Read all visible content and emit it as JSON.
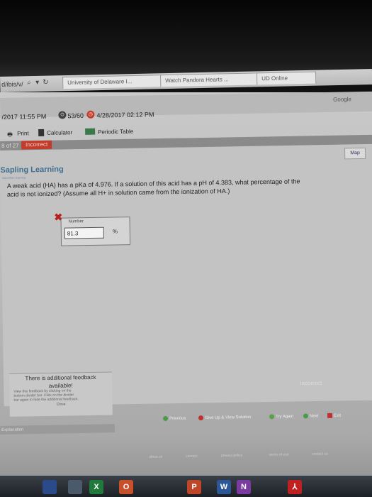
{
  "browser": {
    "url_fragment": "d/ibis/v/",
    "tabs": [
      "University of Delaware I...",
      "Watch Pandora Hearts ...",
      "UD Online"
    ],
    "right_tab": "Google"
  },
  "timer": {
    "start": "/2017 11:55 PM",
    "attempts": "53/60",
    "due": "4/28/2017 02:12 PM"
  },
  "tools": {
    "print": "Print",
    "calculator": "Calculator",
    "periodic_table": "Periodic Table"
  },
  "question_bar": {
    "number": "8 of 27",
    "status": "Incorrect"
  },
  "header": {
    "logo": "Sapling Learning",
    "logo_sub": "macmillan learning",
    "map": "Map"
  },
  "question": {
    "line1": "A weak acid (HA) has a pKa of 4.976. If a solution of this acid has a pH of 4.383, what percentage of the",
    "line2": "acid is not ionized? (Assume all H+ in solution came from the ionization of HA.)"
  },
  "answer": {
    "label": "Number",
    "value": "81.3",
    "unit": "%"
  },
  "feedback": {
    "title_line1": "There is additional feedback",
    "title_line2": "available!",
    "help1": "View this feedback by clicking on the",
    "help2": "bottom divider bar. Click on the divider",
    "help3": "bar again to hide the additional feedback.",
    "close": "Close"
  },
  "status_text": "Incorrect",
  "controls": {
    "previous": "Previous",
    "give_up": "Give Up & View Solution",
    "try_again": "Try Again",
    "next": "Next",
    "exit": "Exit"
  },
  "explanation_label": "Explanation",
  "footer": [
    "about us",
    "careers",
    "privacy policy",
    "terms of use",
    "contact us"
  ],
  "taskbar": [
    "X",
    "O",
    "P",
    "W",
    "N"
  ],
  "colors": {
    "incorrect_red": "#c23b2b",
    "logo_blue": "#3f6f8f",
    "give_up_red": "#c03030",
    "try_again_green": "#5aa04a",
    "next_green": "#4a9a4a",
    "previous_green": "#4a9a4a"
  }
}
